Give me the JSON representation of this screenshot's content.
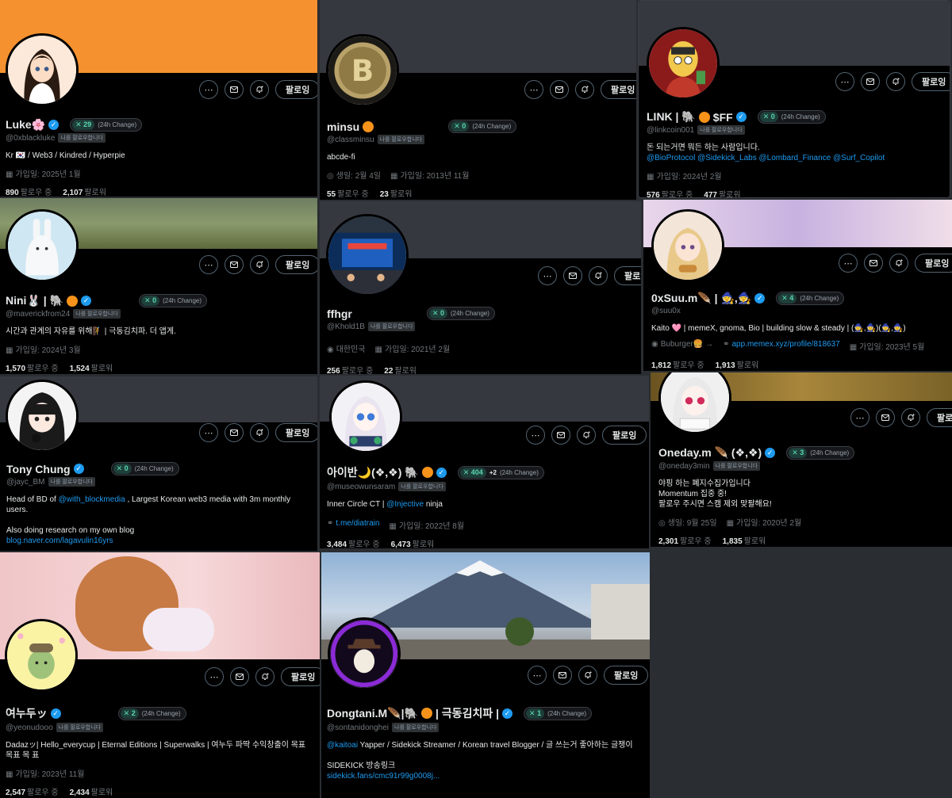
{
  "common": {
    "follows_you": "나를 팔로우합니다",
    "change_label": "(24h Change)",
    "following_btn": "팔로잉",
    "following_label": "팔로우 중",
    "followers_label": "팔로워",
    "more_glyph": "⋯",
    "kaito_x": "✕"
  },
  "colors": {
    "accent": "#1d9bf0",
    "kaito": "#5bd6b3",
    "bg": "#000000"
  },
  "cards": {
    "c1": {
      "name": "Luke🌸",
      "handle": "@0xblackluke",
      "k": "29",
      "bio": "Kr 🇰🇷 / Web3 / Kindred / Hyperpie",
      "joined": "가입일: 2025년 1월",
      "following": "890",
      "followers": "2,107"
    },
    "c2": {
      "name": "minsu",
      "handle": "@classminsu",
      "k": "0",
      "bio": "abcde-fi",
      "birth": "생일: 2월 4일",
      "joined": "가입일: 2013년 11월",
      "following": "55",
      "followers": "23"
    },
    "c3": {
      "name": "LINK | 🐘",
      "name2": "$FF",
      "handle": "@linkcoin001",
      "k": "0",
      "bio": "돈 되는거면 뭐든 하는 사람입니다.",
      "bio_links": "@BioProtocol @Sidekick_Labs @Lombard_Finance @Surf_Copilot",
      "joined": "가입일: 2024년 2월",
      "following": "576",
      "followers": "477"
    },
    "c4": {
      "name": "Nini🐰 | 🐘",
      "handle": "@maverickfrom24",
      "k": "0",
      "bio": "시간과 관계의 자유를 위해🧗 | 극동김치파. 더 앱게.",
      "joined": "가입일: 2024년 3월",
      "following": "1,570",
      "followers": "1,524"
    },
    "c5": {
      "name": "ffhgr",
      "handle": "@Khold1B",
      "k": "0",
      "location": "대한민국",
      "joined": "가입일: 2021년 2월",
      "following": "256",
      "followers": "22"
    },
    "c6": {
      "name": "0xSuu.m🪶 | 🧙,🧙",
      "handle": "@suu0x",
      "k": "4",
      "bio": "Kaito 🩷 | memeX, gnoma, Bio | building slow & steady | (🧙,🧙)(🧙,🧙)",
      "location": "Buburger🍔 →",
      "url": "app.memex.xyz/profile/818637",
      "joined": "가입일: 2023년 5월",
      "following": "1,812",
      "followers": "1,913"
    },
    "c7": {
      "name": "Tony Chung",
      "handle": "@jayc_BM",
      "k": "0",
      "bio_pre": "Head of BD of ",
      "bio_link": "@with_blockmedia",
      "bio_post": " , Largest Korean web3 media with 3m monthly users.",
      "bio2": "Also doing research on my own blog",
      "blog": "blog.naver.com/lagavulin16yrs"
    },
    "c8": {
      "name": "아이반🌙(❖,❖) 🐘",
      "handle": "@museowunsaram",
      "k": "404",
      "delta": "+2",
      "bio_pre": "Inner Circle CT | ",
      "bio_link": "@Injective",
      "bio_post": " ninja",
      "url": "t.me/diatrain",
      "joined": "가입일: 2022년 8월",
      "following": "3,484",
      "followers": "6,473"
    },
    "c9": {
      "name": "Oneday.m 🪶 (❖,❖)",
      "handle": "@oneday3min",
      "k": "3",
      "bio1": "야핑 하는 폐지수집가입니다",
      "bio2": "Momentum 집중 중!",
      "bio3": "팔로우 주시면 스캠 제외 맞팔해요!",
      "birth": "생일: 9월 25일",
      "joined": "가입일: 2020년 2월",
      "following": "2,301",
      "followers": "1,835"
    },
    "c10": {
      "name": "여누두ッ",
      "handle": "@yeonudooo",
      "k": "2",
      "bio": "Dadazッ| Hello_everycup | Eternal Editions | Superwalks | 여누두 파딱 수익창출이 목표 목표 목 표",
      "joined": "가입일: 2023년 11월",
      "following": "2,547",
      "followers": "2,434"
    },
    "c11": {
      "name": "Dongtani.M🪶|🐘",
      "name2": "| 극동김치파 |",
      "handle": "@sontanidonghei",
      "k": "1",
      "bio_link": "@kaitoai",
      "bio_post": " Yapper /  Sidekick Streamer / Korean travel Blogger / 글 쓰는거 좋아하는 글쟁이",
      "bio2": "SIDEKICK 방송링크",
      "url": "sidekick.fans/cmc91r99g0008j..."
    }
  }
}
